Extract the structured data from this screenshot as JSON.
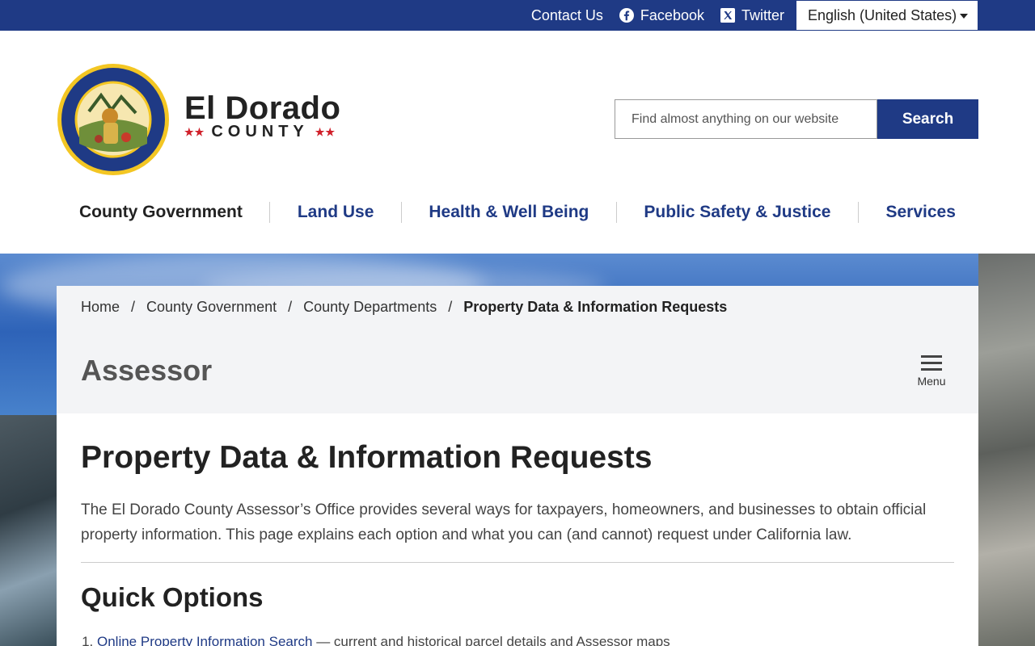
{
  "topbar": {
    "contact": "Contact Us",
    "facebook": "Facebook",
    "twitter": "Twitter",
    "language": "English (United States)",
    "colors": {
      "bar": "#1f3a85"
    }
  },
  "header": {
    "name_line": "El Dorado",
    "county_line": "COUNTY",
    "stars": "★★",
    "seal_icon": "county-seal-icon"
  },
  "search": {
    "placeholder": "Find almost anything on our website",
    "button": "Search"
  },
  "nav": [
    {
      "label": "County Government"
    },
    {
      "label": "Land Use"
    },
    {
      "label": "Health & Well Being"
    },
    {
      "label": "Public Safety & Justice"
    },
    {
      "label": "Services"
    }
  ],
  "breadcrumb": [
    "Home",
    "County Government",
    "County Departments",
    "Property Data & Information Requests"
  ],
  "breadcrumb_sep": "/",
  "department": "Assessor",
  "menu_label": "Menu",
  "page": {
    "title": "Property Data & Information Requests",
    "intro": "The El Dorado County Assessor’s Office provides several ways for taxpayers, homeowners, and businesses to obtain official property information. This page explains each option and what you can (and cannot) request under California law.",
    "section_title": "Quick Options",
    "options": [
      {
        "link": "Online Property Information Search",
        "desc": " — current and historical parcel details and Assessor maps"
      }
    ]
  }
}
